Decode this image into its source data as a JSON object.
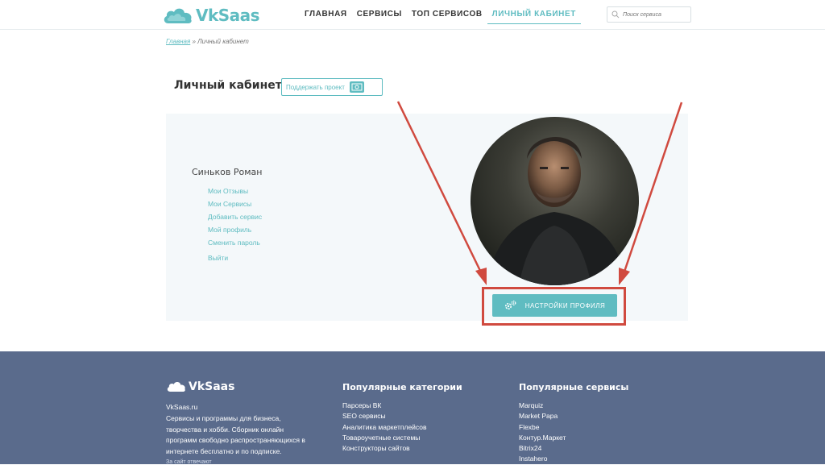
{
  "header": {
    "logo_text": "VkSaas",
    "nav": [
      "Главная",
      "Сервисы",
      "Топ сервисов",
      "Личный кабинет"
    ],
    "search_placeholder": "Поиск сервиса"
  },
  "breadcrumb": {
    "home": "Главная",
    "separator": " » ",
    "current": "Личный кабинет"
  },
  "page": {
    "title": "Личный кабинет",
    "support_label": "Поддержать проект"
  },
  "profile": {
    "name": "Синьков Роман",
    "menu": [
      "Мои Отзывы",
      "Мои Сервисы",
      "Добавить сервис",
      "Мой профиль",
      "Сменить пароль",
      "Выйти"
    ],
    "settings_label": "Настройки профиля"
  },
  "footer": {
    "logo_text": "VkSaas",
    "site": "VkSaas.ru",
    "description": "Сервисы и программы для бизнеса, творчества и хобби. Сборник онлайн программ свободно распространяющихся в интернете бесплатно и по подписке.",
    "extra": "За сайт отвечают",
    "categories_title": "Популярные категории",
    "categories": [
      "Парсеры ВК",
      "SEO сервисы",
      "Аналитика маркетплейсов",
      "Товароучетные системы",
      "Конструкторы сайтов"
    ],
    "services_title": "Популярные сервисы",
    "services": [
      "Marquiz",
      "Market Papa",
      "Flexbe",
      "Контур.Маркет",
      "Bitrix24",
      "Instahero"
    ]
  },
  "colors": {
    "accent": "#5fbcc1",
    "footer_bg": "#5a6b8c",
    "annotation": "#d04a3f"
  }
}
